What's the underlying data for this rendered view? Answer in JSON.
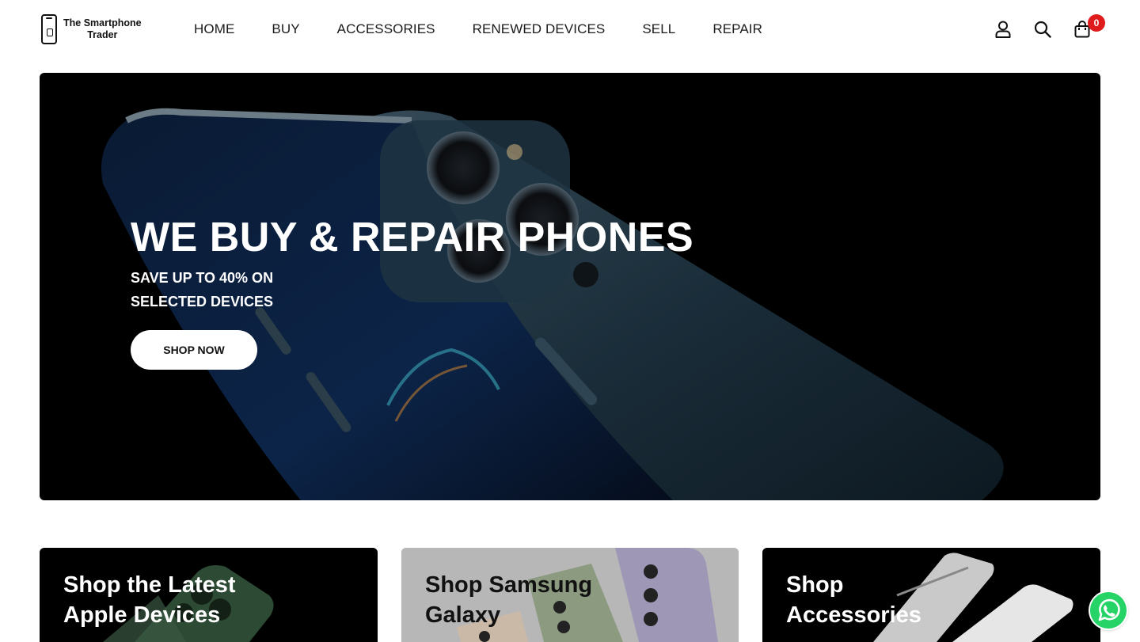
{
  "brand": {
    "line1": "The Smartphone",
    "line2": "Trader"
  },
  "nav": {
    "items": [
      {
        "label": "HOME"
      },
      {
        "label": "BUY"
      },
      {
        "label": "ACCESSORIES"
      },
      {
        "label": "RENEWED DEVICES"
      },
      {
        "label": "SELL"
      },
      {
        "label": "REPAIR"
      }
    ]
  },
  "header_icons": {
    "account": "user-icon",
    "search": "search-icon",
    "cart": "cart-icon",
    "cart_count": "0"
  },
  "hero": {
    "title": "WE BUY & REPAIR PHONES",
    "subtitle_line1": "SAVE UP TO 40% ON",
    "subtitle_line2": "SELECTED DEVICES",
    "cta": "SHOP NOW"
  },
  "cards": [
    {
      "title": "Shop the Latest Apple Devices"
    },
    {
      "title": "Shop Samsung Galaxy"
    },
    {
      "title": "Shop Accessories"
    }
  ],
  "colors": {
    "accent_badge": "#e01b1b",
    "hero_bg": "#000000",
    "whatsapp": "#25d366"
  },
  "floating": {
    "whatsapp": "whatsapp-icon"
  }
}
